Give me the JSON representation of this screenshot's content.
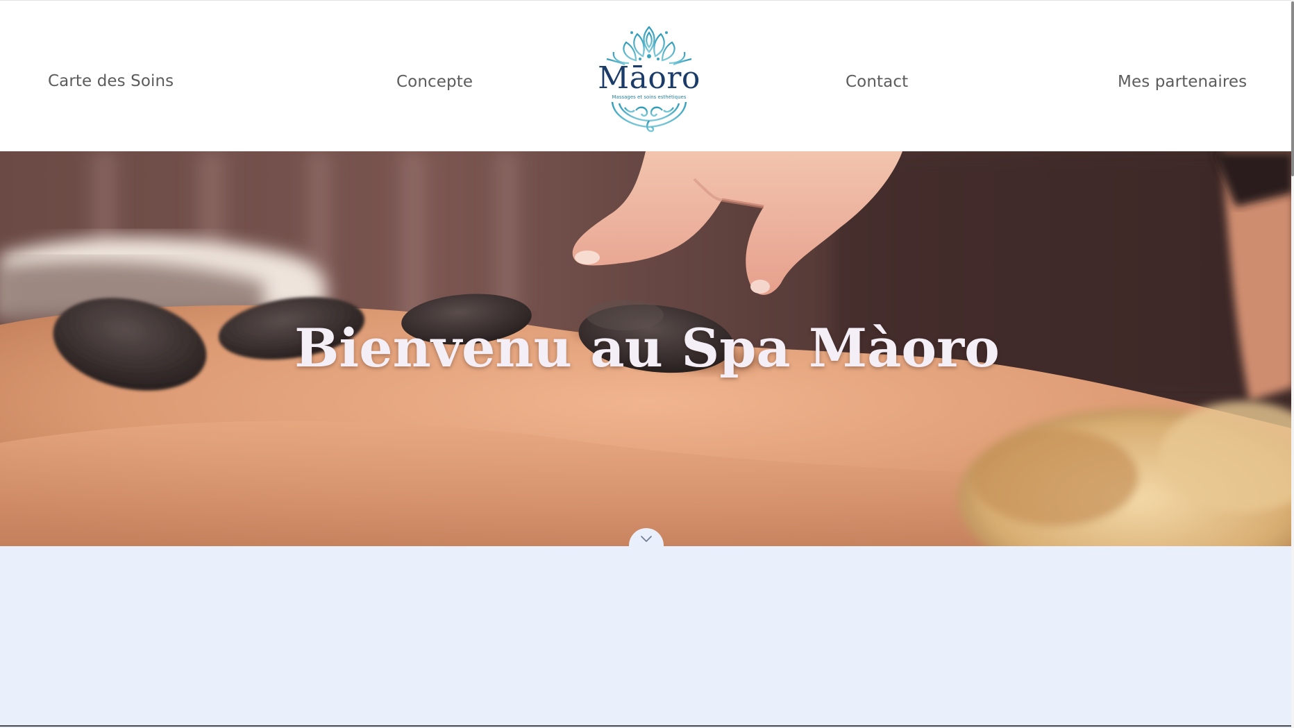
{
  "nav": {
    "left_items": [
      {
        "label": "Carte des Soins"
      },
      {
        "label": "Concepte"
      }
    ],
    "right_items": [
      {
        "label": "Contact"
      },
      {
        "label": "Mes partenaires"
      }
    ]
  },
  "logo": {
    "wordmark": "Māoro",
    "tagline": "Massages et soins esthétiques",
    "icon": "lotus-mandala-icon"
  },
  "hero": {
    "title": "Bienvenu au Spa Màoro",
    "image": "hot-stone-massage-photo",
    "scroll_icon": "chevron-down-icon"
  },
  "colors": {
    "nav_text": "#5c5c5c",
    "logo_navy": "#1b3c69",
    "logo_teal": "#3aa4bf",
    "hero_title": "#f4eef7",
    "section_bg": "#e9f0fc"
  }
}
